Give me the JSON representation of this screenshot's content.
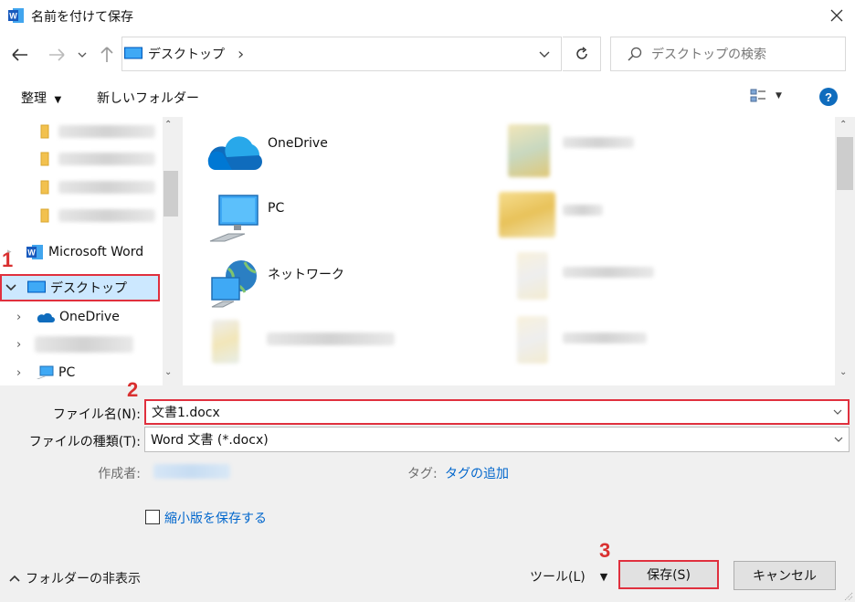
{
  "window": {
    "title": "名前を付けて保存"
  },
  "address": {
    "path": "デスクトップ",
    "separator": "›"
  },
  "search": {
    "placeholder": "デスクトップの検索"
  },
  "toolbar": {
    "organize": "整理",
    "new_folder": "新しいフォルダー"
  },
  "sidebar": {
    "word": "Microsoft Word",
    "desktop": "デスクトップ",
    "onedrive": "OneDrive",
    "pc": "PC"
  },
  "content": {
    "items": [
      {
        "label": "OneDrive",
        "icon": "onedrive-cloud-icon"
      },
      {
        "label": "PC",
        "icon": "computer-icon"
      },
      {
        "label": "ネットワーク",
        "icon": "network-icon"
      }
    ]
  },
  "form": {
    "filename_label": "ファイル名(N):",
    "filename_value": "文書1.docx",
    "filetype_label": "ファイルの種類(T):",
    "filetype_value": "Word 文書 (*.docx)",
    "author_label": "作成者:",
    "tag_label": "タグ:",
    "tag_link": "タグの追加",
    "thumbnail_label": "縮小版を保存する"
  },
  "footer": {
    "hide_folders": "フォルダーの非表示",
    "tools": "ツール(L)",
    "save": "保存(S)",
    "cancel": "キャンセル"
  },
  "annotations": {
    "step1": "1",
    "step2": "2",
    "step3": "3"
  },
  "colors": {
    "accent": "#0078d7",
    "highlight_border": "#e0303e",
    "selected_bg": "#cce8ff",
    "step_red": "#d93030"
  }
}
